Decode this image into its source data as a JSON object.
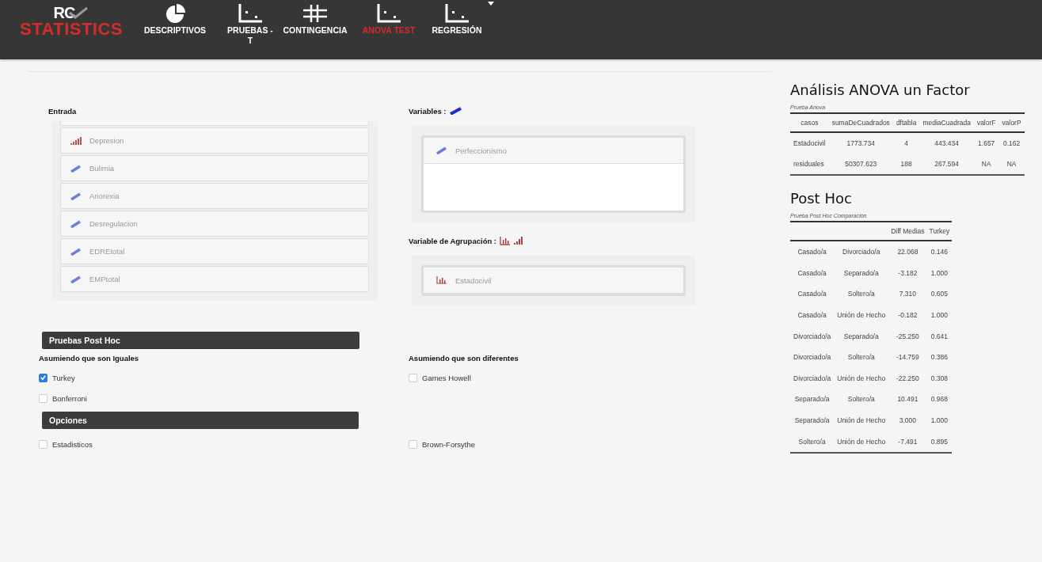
{
  "brand": {
    "line1": "RC",
    "line2": "STATISTICS"
  },
  "nav": [
    {
      "label": "DESCRIPTIVOS",
      "kind": "pie",
      "selected": false
    },
    {
      "label": "PRUEBAS - T",
      "kind": "scatter",
      "selected": false
    },
    {
      "label": "CONTINGENCIA",
      "kind": "grid",
      "selected": false
    },
    {
      "label": "ANOVA TEST",
      "kind": "scatter",
      "selected": true
    },
    {
      "label": "REGRESIÓN",
      "kind": "scatter",
      "selected": false
    }
  ],
  "input": {
    "label": "Entrada",
    "variables": [
      {
        "name": "Depresion",
        "kind": "ordinal"
      },
      {
        "name": "Bulimia",
        "kind": "scale"
      },
      {
        "name": "Anorexia",
        "kind": "scale"
      },
      {
        "name": "Desregulacion",
        "kind": "scale"
      },
      {
        "name": "EDREtotal",
        "kind": "scale"
      },
      {
        "name": "EMPtotal",
        "kind": "scale"
      }
    ]
  },
  "variables": {
    "label": "Variables :",
    "icons": [
      {
        "kind": "scale"
      }
    ],
    "items": [
      {
        "name": "Perfeccionismo",
        "kind": "scale"
      }
    ]
  },
  "grouping": {
    "label": "Variable de Agrupación :",
    "icons": [
      {
        "kind": "nominal"
      },
      {
        "kind": "ordinal"
      }
    ],
    "items": [
      {
        "name": "Estadocivil",
        "kind": "nominal"
      }
    ]
  },
  "post_hoc": {
    "title": "Pruebas Post Hoc",
    "equal": {
      "label": "Asumiendo que son Iguales",
      "options": [
        {
          "label": "Turkey",
          "checked": true
        },
        {
          "label": "Bonferroni",
          "checked": false
        }
      ]
    },
    "different": {
      "label": "Asumiendo que son diferentes",
      "options": [
        {
          "label": "Games Howell",
          "checked": false
        }
      ]
    }
  },
  "options": {
    "title": "Opciones",
    "left": [
      {
        "label": "Estadisticos",
        "checked": false
      }
    ],
    "right": [
      {
        "label": "Brown-Forsythe",
        "checked": false
      }
    ]
  },
  "anova": {
    "title": "Análisis ANOVA un Factor",
    "caption": "Prueba Anova",
    "columns": [
      "casos",
      "sumaDeCuadrados",
      "dftabla",
      "mediaCuadrada",
      "valorF",
      "valorP"
    ],
    "rows": [
      [
        "Estadocivil",
        "1773.734",
        "4",
        "443.434",
        "1.657",
        "0.162"
      ],
      [
        "residuales",
        "50307.623",
        "188",
        "267.594",
        "NA",
        "NA"
      ]
    ]
  },
  "post_hoc_table": {
    "title": "Post Hoc",
    "caption": "Prueba Post Hoc Comparación",
    "columns": [
      "",
      "",
      "Diff Medias",
      "Turkey"
    ],
    "rows": [
      [
        "Casado/a",
        "Divorciado/a",
        "22.068",
        "0.146"
      ],
      [
        "Casado/a",
        "Separado/a",
        "-3.182",
        "1.000"
      ],
      [
        "Casado/a",
        "Soltero/a",
        "7.310",
        "0.605"
      ],
      [
        "Casado/a",
        "Unión de Hecho",
        "-0.182",
        "1.000"
      ],
      [
        "Divorciado/a",
        "Separado/a",
        "-25.250",
        "0.641"
      ],
      [
        "Divorciado/a",
        "Soltero/a",
        "-14.759",
        "0.386"
      ],
      [
        "Divorciado/a",
        "Unión de Hecho",
        "-22.250",
        "0.308"
      ],
      [
        "Separado/a",
        "Soltero/a",
        "10.491",
        "0.968"
      ],
      [
        "Separado/a",
        "Unión de Hecho",
        "3.000",
        "1.000"
      ],
      [
        "Soltero/a",
        "Unión de Hecho",
        "-7.491",
        "0.895"
      ]
    ]
  }
}
